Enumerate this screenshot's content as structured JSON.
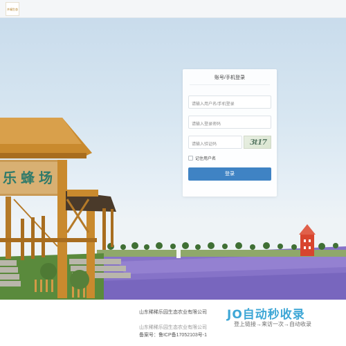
{
  "header": {
    "logo_text": "卉福生态"
  },
  "login": {
    "title": "账号/手机登录",
    "username_placeholder": "请输入用户名/手机登录",
    "password_placeholder": "请输入登录密码",
    "captcha_placeholder": "请输入验证码",
    "captcha_text": "3t17",
    "remember_label": "记住用户名",
    "submit_label": "登录"
  },
  "hero": {
    "sign_text": "乐蜂场"
  },
  "footer": {
    "company": "山东稀稀乐园生态农业有限公司",
    "copyright": "山东稀稀乐园生态农业有限公司",
    "icp": "备案号：鲁ICP备17052103号-1"
  },
  "watermark": {
    "brand": "JO自动秒收录",
    "tagline": "登上链接→来访一次→自动收录"
  },
  "colors": {
    "primary": "#3f83c4",
    "lavender": "#7f6fc7",
    "wood": "#c98a2e",
    "tower": "#d8452e"
  }
}
